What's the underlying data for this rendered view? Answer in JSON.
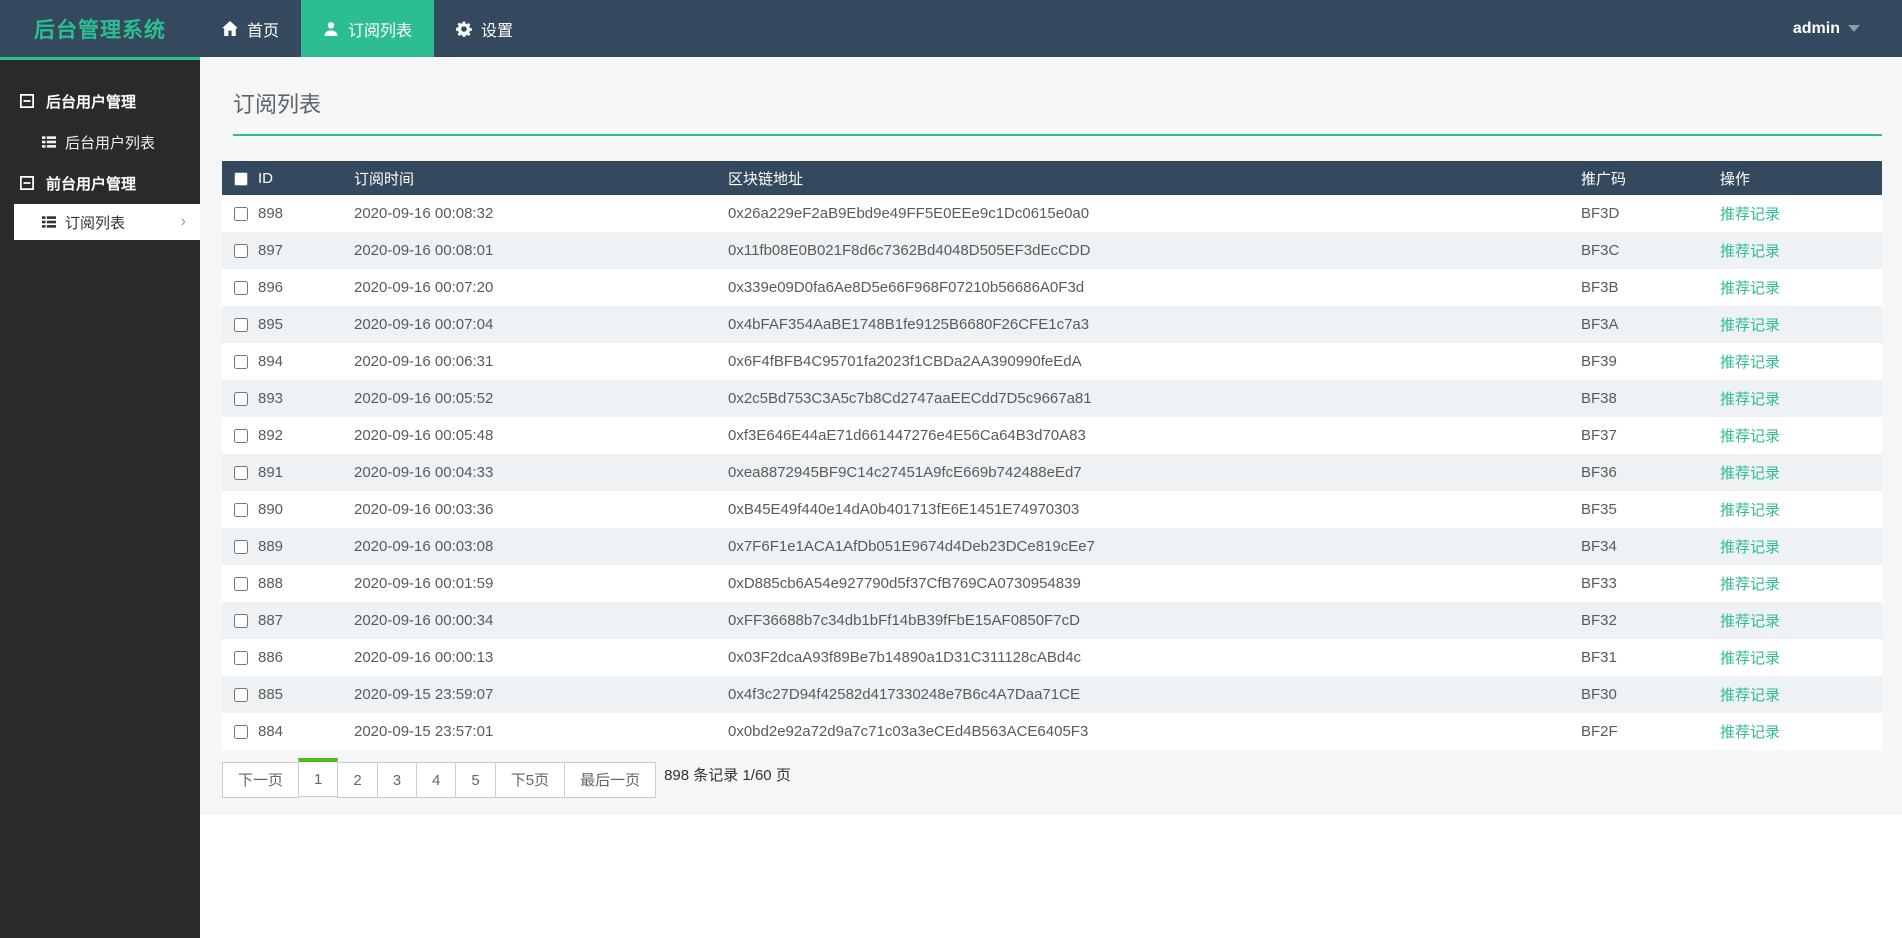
{
  "navbar": {
    "logo": "后台管理系统",
    "items": [
      {
        "label": "首页",
        "icon": "home-icon",
        "active": false
      },
      {
        "label": "订阅列表",
        "icon": "user-icon",
        "active": true
      },
      {
        "label": "设置",
        "icon": "gear-icon",
        "active": false
      }
    ],
    "user": "admin"
  },
  "sidebar": {
    "groups": [
      {
        "label": "后台用户管理",
        "items": [
          {
            "label": "后台用户列表",
            "active": false
          }
        ]
      },
      {
        "label": "前台用户管理",
        "items": [
          {
            "label": "订阅列表",
            "active": true
          }
        ]
      }
    ]
  },
  "main": {
    "title": "订阅列表",
    "table": {
      "columns": {
        "id": "ID",
        "time": "订阅时间",
        "address": "区块链地址",
        "code": "推广码",
        "action": "操作"
      },
      "action_label": "推荐记录",
      "rows": [
        {
          "id": "898",
          "time": "2020-09-16 00:08:32",
          "address": "0x26a229eF2aB9Ebd9e49FF5E0EEe9c1Dc0615e0a0",
          "code": "BF3D"
        },
        {
          "id": "897",
          "time": "2020-09-16 00:08:01",
          "address": "0x11fb08E0B021F8d6c7362Bd4048D505EF3dEcCDD",
          "code": "BF3C"
        },
        {
          "id": "896",
          "time": "2020-09-16 00:07:20",
          "address": "0x339e09D0fa6Ae8D5e66F968F07210b56686A0F3d",
          "code": "BF3B"
        },
        {
          "id": "895",
          "time": "2020-09-16 00:07:04",
          "address": "0x4bFAF354AaBE1748B1fe9125B6680F26CFE1c7a3",
          "code": "BF3A"
        },
        {
          "id": "894",
          "time": "2020-09-16 00:06:31",
          "address": "0x6F4fBFB4C95701fa2023f1CBDa2AA390990feEdA",
          "code": "BF39"
        },
        {
          "id": "893",
          "time": "2020-09-16 00:05:52",
          "address": "0x2c5Bd753C3A5c7b8Cd2747aaEECdd7D5c9667a81",
          "code": "BF38"
        },
        {
          "id": "892",
          "time": "2020-09-16 00:05:48",
          "address": "0xf3E646E44aE71d661447276e4E56Ca64B3d70A83",
          "code": "BF37"
        },
        {
          "id": "891",
          "time": "2020-09-16 00:04:33",
          "address": "0xea8872945BF9C14c27451A9fcE669b742488eEd7",
          "code": "BF36"
        },
        {
          "id": "890",
          "time": "2020-09-16 00:03:36",
          "address": "0xB45E49f440e14dA0b401713fE6E1451E74970303",
          "code": "BF35"
        },
        {
          "id": "889",
          "time": "2020-09-16 00:03:08",
          "address": "0x7F6F1e1ACA1AfDb051E9674d4Deb23DCe819cEe7",
          "code": "BF34"
        },
        {
          "id": "888",
          "time": "2020-09-16 00:01:59",
          "address": "0xD885cb6A54e927790d5f37CfB769CA0730954839",
          "code": "BF33"
        },
        {
          "id": "887",
          "time": "2020-09-16 00:00:34",
          "address": "0xFF36688b7c34db1bFf14bB39fFbE15AF0850F7cD",
          "code": "BF32"
        },
        {
          "id": "886",
          "time": "2020-09-16 00:00:13",
          "address": "0x03F2dcaA93f89Be7b14890a1D31C311128cABd4c",
          "code": "BF31"
        },
        {
          "id": "885",
          "time": "2020-09-15 23:59:07",
          "address": "0x4f3c27D94f42582d417330248e7B6c4A7Daa71CE",
          "code": "BF30"
        },
        {
          "id": "884",
          "time": "2020-09-15 23:57:01",
          "address": "0x0bd2e92a72d9a7c71c03a3eCEd4B563ACE6405F3",
          "code": "BF2F"
        }
      ]
    },
    "pagination": {
      "buttons": [
        {
          "label": "下一页",
          "active": false
        },
        {
          "label": "1",
          "active": true
        },
        {
          "label": "2",
          "active": false
        },
        {
          "label": "3",
          "active": false
        },
        {
          "label": "4",
          "active": false
        },
        {
          "label": "5",
          "active": false
        },
        {
          "label": "下5页",
          "active": false
        },
        {
          "label": "最后一页",
          "active": false
        }
      ],
      "summary": "898 条记录 1/60 页"
    }
  },
  "colors": {
    "accent_teal": "#2cbe90",
    "navbar_bg": "#34495e",
    "sidebar_bg": "#2a2a2a",
    "table_header_bg": "#34495e",
    "zebra_row": "#eff2f4",
    "active_page_green": "#4cbb17",
    "link_color": "#2cbe90"
  }
}
